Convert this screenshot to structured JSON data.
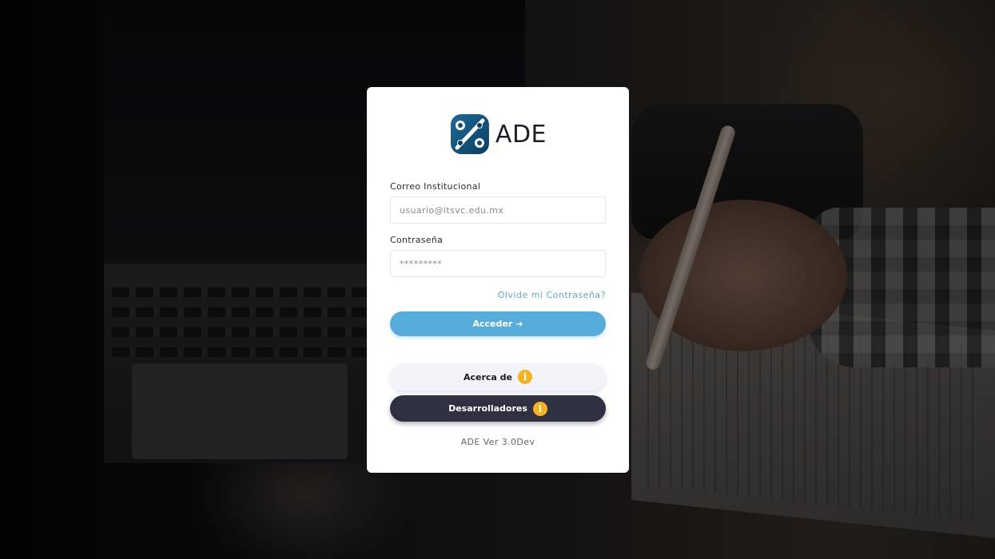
{
  "brand": {
    "name": "ADE",
    "logo_icon": "ade-logo-icon",
    "logo_colors": {
      "primary": "#0d4e73",
      "secondary": "#17689a"
    }
  },
  "form": {
    "email_label": "Correo Institucional",
    "email_placeholder": "usuario@itsvc.edu.mx",
    "password_label": "Contraseña",
    "password_placeholder": "*********",
    "forgot_link": "Olvide mi Contraseña?",
    "login_button": "Acceder",
    "login_icon": "arrow-right-icon"
  },
  "buttons": {
    "about": "Acerca de",
    "developers": "Desarrolladores",
    "info_icon": "info-icon"
  },
  "footer": {
    "version": "ADE Ver 3.0Dev"
  },
  "colors": {
    "accent": "#56acda",
    "dark_button": "#2f3140",
    "light_button": "#f3f3fa",
    "info_badge": "#f4b31f"
  }
}
